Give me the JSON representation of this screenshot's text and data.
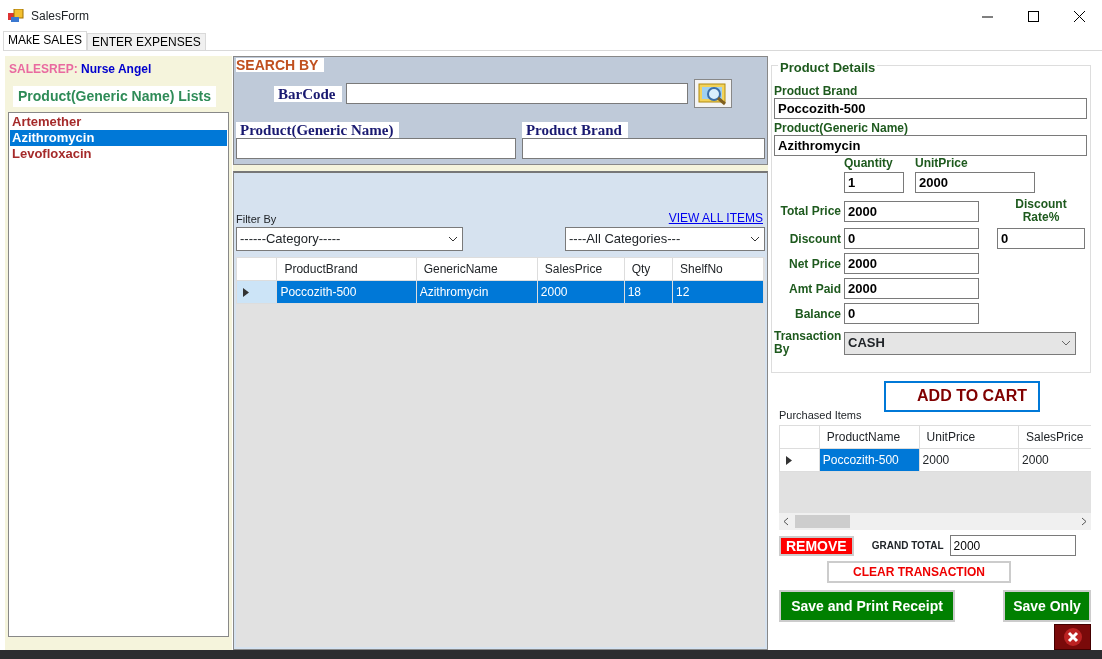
{
  "window": {
    "title": "SalesForm"
  },
  "tabs": [
    {
      "label": "MAkE SALES",
      "selected": true
    },
    {
      "label": "ENTER EXPENSES",
      "selected": false
    }
  ],
  "salesrep": {
    "label": "SALESREP:",
    "value": "Nurse Angel"
  },
  "product_list": {
    "title": "Product(Generic Name) Lists",
    "items": [
      {
        "label": "Artemether",
        "selected": false
      },
      {
        "label": "Azithromycin",
        "selected": true
      },
      {
        "label": "Levofloxacin",
        "selected": false
      }
    ]
  },
  "search": {
    "title": "SEARCH BY",
    "barcode_label": "BarCode",
    "generic_label": "Product(Generic Name)",
    "brand_label": "Product Brand"
  },
  "filter": {
    "label": "Filter By",
    "link": "VIEW ALL ITEMS",
    "category": "------Category-----",
    "all_categories": "----All Categories---"
  },
  "products_table": {
    "columns": [
      "ProductBrand",
      "GenericName",
      "SalesPrice",
      "Qty",
      "ShelfNo"
    ],
    "rows": [
      {
        "cells": [
          "Poccozith-500",
          "Azithromycin",
          "2000",
          "18",
          "12"
        ],
        "selected": true
      }
    ]
  },
  "details": {
    "title": "Product Details",
    "brand": {
      "label": "Product Brand",
      "value": "Poccozith-500"
    },
    "generic": {
      "label": "Product(Generic Name)",
      "value": "Azithromycin"
    },
    "quantity": {
      "label": "Quantity",
      "value": "1"
    },
    "unit_price": {
      "label": "UnitPrice",
      "value": "2000"
    },
    "total_price": {
      "label": "Total Price",
      "value": "2000"
    },
    "discount_rate": {
      "label": "Discount Rate%",
      "value": "0"
    },
    "discount": {
      "label": "Discount",
      "value": "0"
    },
    "net_price": {
      "label": "Net Price",
      "value": "2000"
    },
    "amt_paid": {
      "label": "Amt Paid",
      "value": "2000"
    },
    "balance": {
      "label": "Balance",
      "value": "0"
    },
    "transaction_by": {
      "label": "Transaction By",
      "value": "CASH"
    }
  },
  "add_to_cart": "ADD TO CART",
  "purchased": {
    "label": "Purchased Items",
    "columns": [
      "ProductName",
      "UnitPrice",
      "SalesPrice"
    ],
    "rows": [
      {
        "cells": [
          "Poccozith-500",
          "2000",
          "2000"
        ],
        "selected": true
      }
    ]
  },
  "remove": "REMOVE",
  "grand_total": {
    "label": "GRAND TOTAL",
    "value": "2000"
  },
  "clear": "CLEAR TRANSACTION",
  "buttons": [
    "Save and Print Receipt",
    "Save Only"
  ]
}
